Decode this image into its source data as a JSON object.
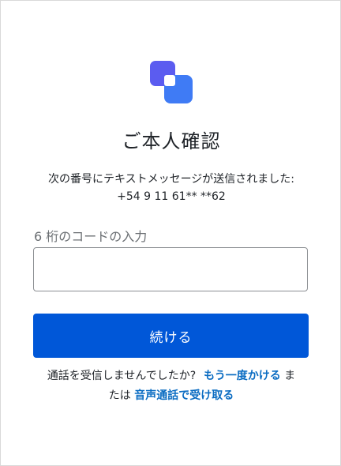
{
  "brand": {
    "accent_color": "#0057d8",
    "logo_icon": "two-overlapping-squares-logo-icon"
  },
  "page": {
    "title": "ご本人確認",
    "description_line1": "次の番号にテキストメッセージが送信されました:",
    "phone_number": "+54 9 11 61** **62"
  },
  "form": {
    "code_label": "6 桁のコードの入力",
    "code_value": "",
    "continue_label": "続ける"
  },
  "footer": {
    "question": "通話を受信しませんでしたか?",
    "resend_link": "もう一度かける",
    "or_part1": "ま",
    "or_part2": "たは",
    "voice_call_link": "音声通話で受け取る"
  }
}
